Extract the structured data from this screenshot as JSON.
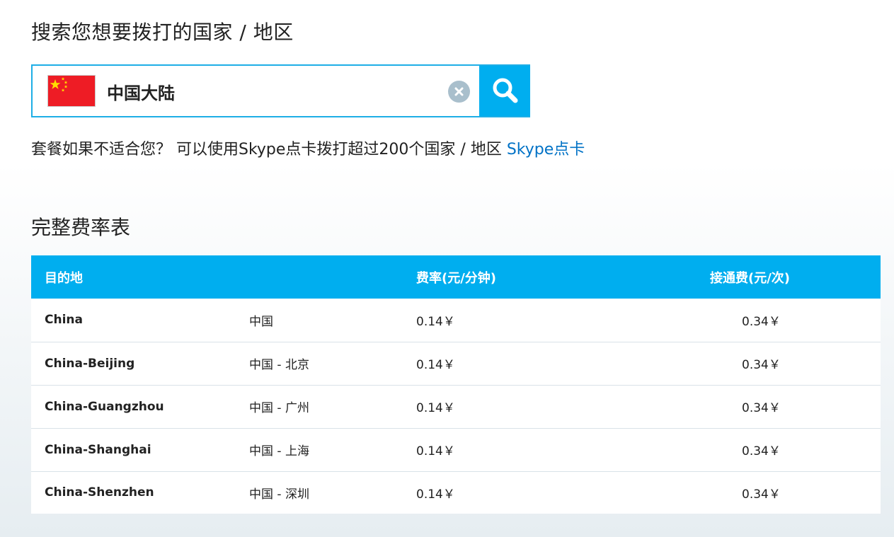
{
  "search": {
    "heading": "搜索您想要拨打的国家 / 地区",
    "value": "中国大陆",
    "flag_icon": "china-flag-icon",
    "clear_icon": "clear-icon",
    "search_icon": "magnifier-icon"
  },
  "promo": {
    "text": "套餐如果不适合您？ 可以使用Skype点卡拨打超过200个国家 / 地区 ",
    "link_label": "Skype点卡"
  },
  "rates": {
    "heading": "完整费率表",
    "columns": [
      "目的地",
      "费率(元/分钟)",
      "接通费(元/次)"
    ],
    "rows": [
      {
        "destination": "China",
        "local_name": "中国",
        "rate": "0.14￥",
        "connection_fee": "0.34￥"
      },
      {
        "destination": "China-Beijing",
        "local_name": "中国 - 北京",
        "rate": "0.14￥",
        "connection_fee": "0.34￥"
      },
      {
        "destination": "China-Guangzhou",
        "local_name": "中国 - 广州",
        "rate": "0.14￥",
        "connection_fee": "0.34￥"
      },
      {
        "destination": "China-Shanghai",
        "local_name": "中国 - 上海",
        "rate": "0.14￥",
        "connection_fee": "0.34￥"
      },
      {
        "destination": "China-Shenzhen",
        "local_name": "中国 - 深圳",
        "rate": "0.14￥",
        "connection_fee": "0.34￥"
      }
    ]
  },
  "colors": {
    "accent": "#00aeef",
    "link": "#0072c6",
    "clear_button": "#a9bfcc",
    "flag_red": "#ee1c25",
    "flag_star": "#ffde00"
  }
}
